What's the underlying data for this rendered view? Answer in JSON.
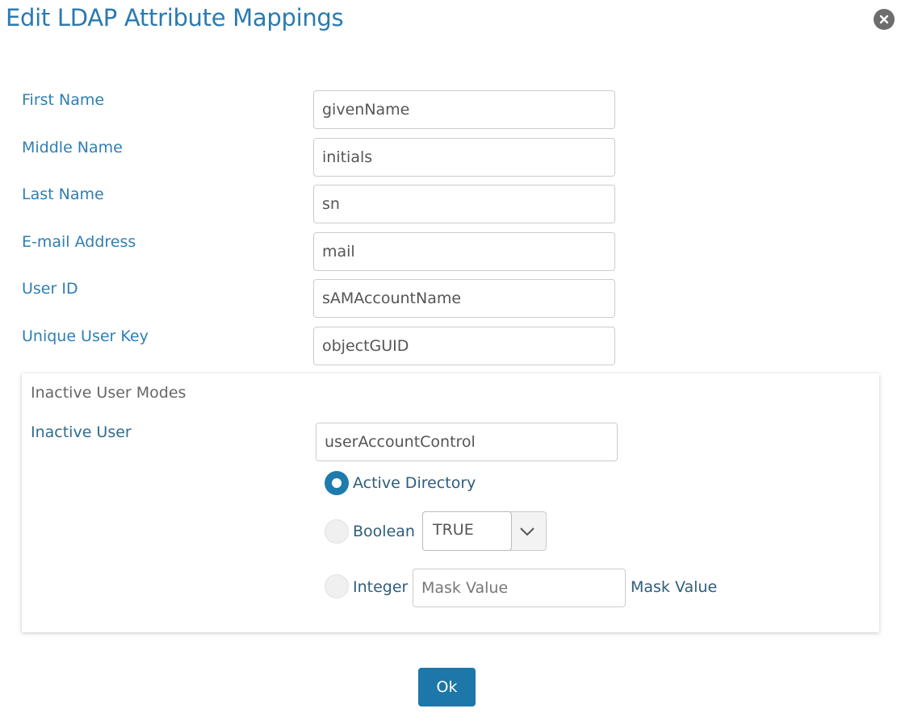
{
  "dialog": {
    "title": "Edit LDAP Attribute Mappings",
    "close_icon": "close-icon"
  },
  "mappings": [
    {
      "label": "First Name",
      "value": "givenName"
    },
    {
      "label": "Middle Name",
      "value": "initials"
    },
    {
      "label": "Last Name",
      "value": "sn"
    },
    {
      "label": "E-mail Address",
      "value": "mail"
    },
    {
      "label": "User ID",
      "value": "sAMAccountName"
    },
    {
      "label": "Unique User Key",
      "value": "objectGUID"
    }
  ],
  "inactive": {
    "section_title": "Inactive User Modes",
    "label": "Inactive User",
    "value": "userAccountControl",
    "modes": {
      "active_directory": {
        "label": "Active Directory",
        "checked": true
      },
      "boolean": {
        "label": "Boolean",
        "checked": false,
        "selected": "TRUE"
      },
      "integer": {
        "label": "Integer",
        "checked": false,
        "placeholder": "Mask Value",
        "suffix": "Mask Value"
      }
    }
  },
  "footer": {
    "ok_label": "Ok"
  },
  "colors": {
    "title": "#2a7ab0",
    "label": "#2f7eb3",
    "primary_button": "#1d77a8",
    "radio_checked": "#1e7bad"
  }
}
